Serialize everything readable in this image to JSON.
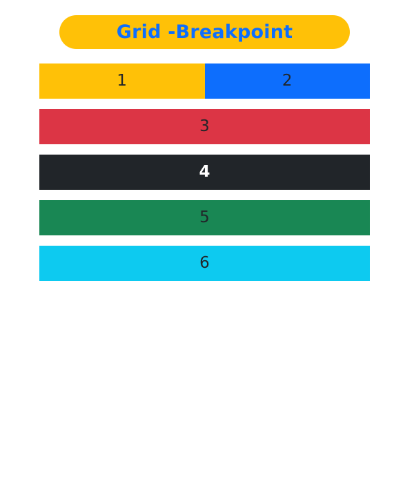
{
  "header": {
    "title": "Grid -Breakpoint",
    "pill_color": "#ffc107",
    "title_color": "#0d6efd"
  },
  "grid": {
    "rows": [
      {
        "cells": [
          {
            "label": "1",
            "bg": "#ffc107",
            "color": "#212529"
          },
          {
            "label": "2",
            "bg": "#0d6efd",
            "color": "#212529"
          }
        ]
      },
      {
        "cells": [
          {
            "label": "3",
            "bg": "#dc3545",
            "color": "#212529"
          }
        ]
      },
      {
        "cells": [
          {
            "label": "4",
            "bg": "#212529",
            "color": "#ffffff"
          }
        ]
      },
      {
        "cells": [
          {
            "label": "5",
            "bg": "#198754",
            "color": "#212529"
          }
        ]
      },
      {
        "cells": [
          {
            "label": "6",
            "bg": "#0dcaf0",
            "color": "#212529"
          }
        ]
      }
    ]
  }
}
